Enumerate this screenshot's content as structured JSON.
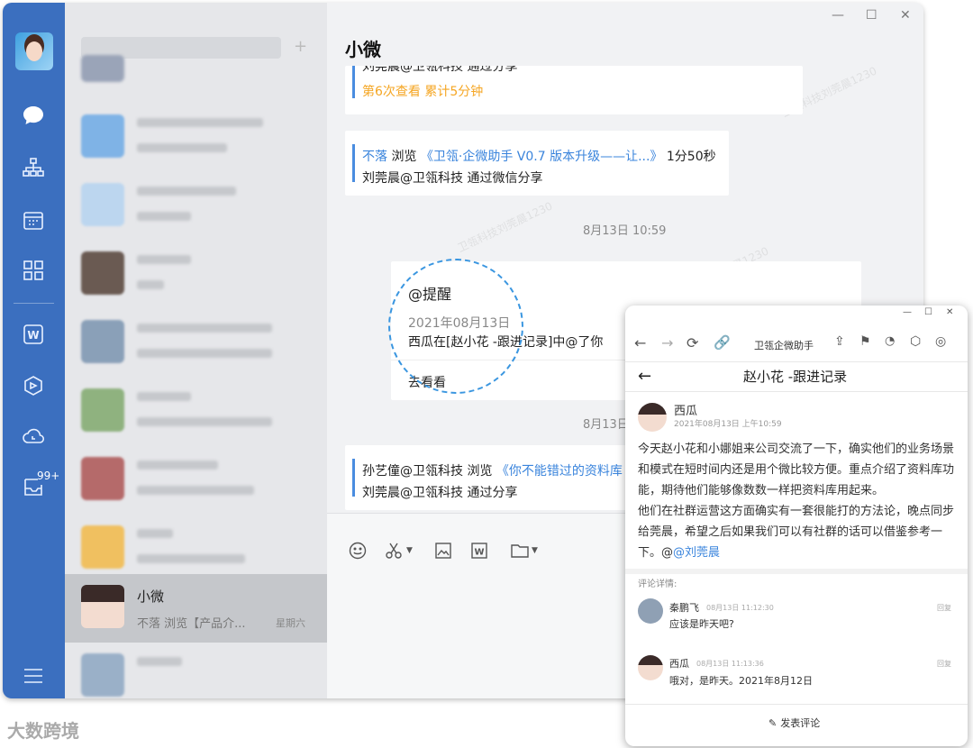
{
  "brand": "大数跨境",
  "sidebar": {
    "badge": "99+"
  },
  "list": {
    "active_chat": {
      "name": "小微",
      "preview": "不落 浏览【产品介...",
      "time": "星期六"
    }
  },
  "chat": {
    "title": "小微",
    "msg1": {
      "line1": "刘莞晨@卫瓴科技 通过分享",
      "stats": "第6次查看 累计5分钟"
    },
    "msg2": {
      "user": "不落",
      "action": " 浏览 ",
      "link": "《卫瓴·企微助手 V0.7 版本升级——让...》",
      "duration": " 1分50秒",
      "line2": "刘莞晨@卫瓴科技 通过微信分享"
    },
    "timestamp1": "8月13日 10:59",
    "remind": {
      "title": "@提醒",
      "date": "2021年08月13日",
      "text": "西瓜在[赵小花 -跟进记录]中@了你",
      "action": "去看看"
    },
    "timestamp2": "8月13日",
    "msg3": {
      "user": "孙艺僮@卫瓴科技",
      "action": " 浏览 ",
      "link": "《你不能错过的资料库",
      "line2": "刘莞晨@卫瓴科技 通过分享"
    },
    "watermark": "卫瓴科技刘莞晨1230"
  },
  "popup": {
    "app_name": "卫瓴企微助手",
    "page_title": "赵小花 -跟进记录",
    "post": {
      "author": "西瓜",
      "time": "2021年08月13日 上午10:59",
      "para1": "今天赵小花和小娜姐来公司交流了一下，确实他们的业务场景和模式在短时间内还是用个微比较方便。重点介绍了资料库功能，期待他们能够像数数一样把资料库用起来。",
      "para2": "他们在社群运营这方面确实有一套很能打的方法论，晚点同步给莞晨，希望之后如果我们可以有社群的话可以借鉴参考一下。@",
      "mention": "@刘莞晨"
    },
    "comments_label": "评论详情:",
    "comments": [
      {
        "author": "秦鹏飞",
        "time": "08月13日 11:12:30",
        "text": "应该是昨天吧?",
        "reply": "回复"
      },
      {
        "author": "西瓜",
        "time": "08月13日 11:13:36",
        "text": "哦对，是昨天。2021年8月12日",
        "reply": "回复"
      }
    ],
    "write_comment": "发表评论"
  }
}
